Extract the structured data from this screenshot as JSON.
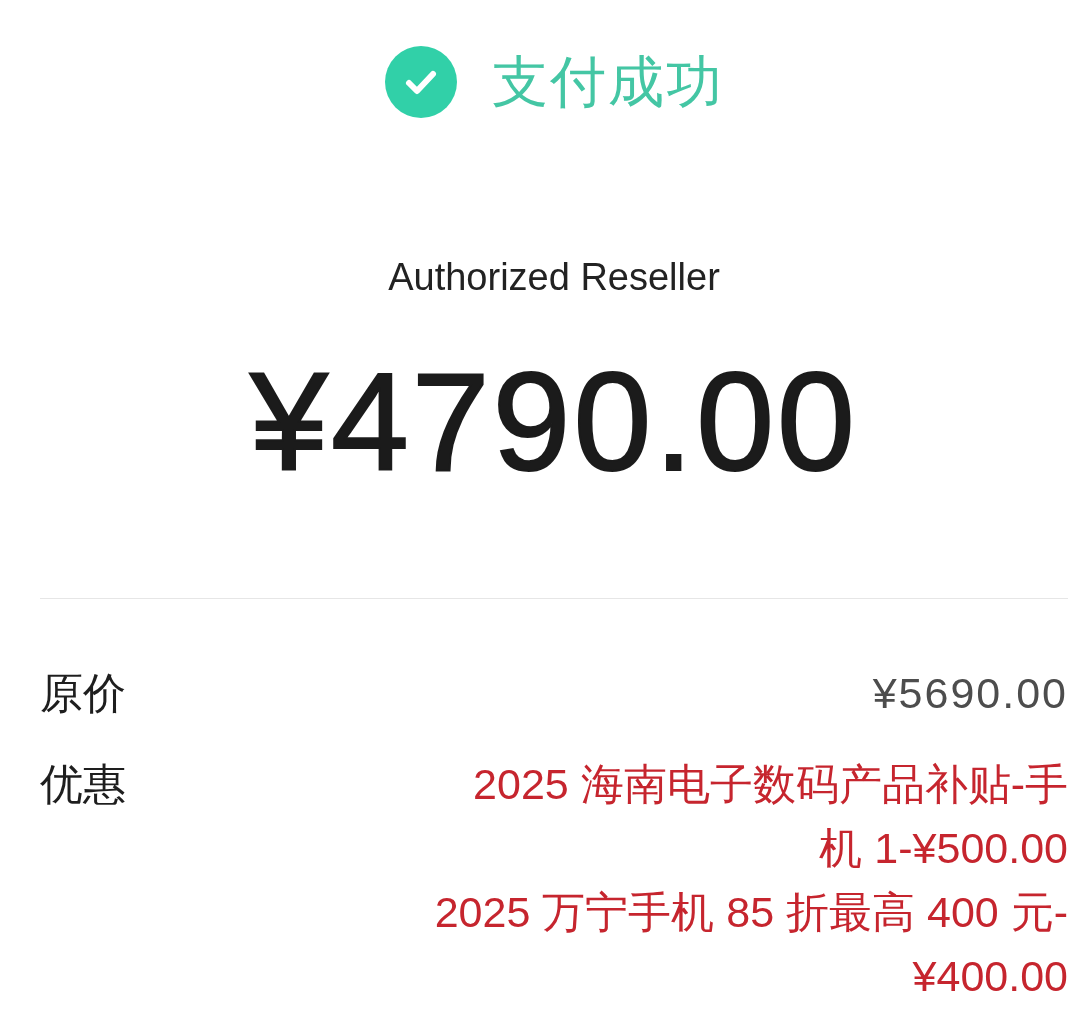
{
  "header": {
    "succeeded": true,
    "title": "支付成功"
  },
  "merchant": "Authorized Reseller",
  "amount": "¥4790.00",
  "details": [
    {
      "kind": "price",
      "label": "原价",
      "value": "¥5690.00"
    },
    {
      "kind": "discounts",
      "label": "优惠",
      "items": [
        "2025 海南电子数码产品补贴-手机 1-¥500.00",
        "2025 万宁手机 85 折最高 400 元-¥400.00"
      ]
    }
  ]
}
